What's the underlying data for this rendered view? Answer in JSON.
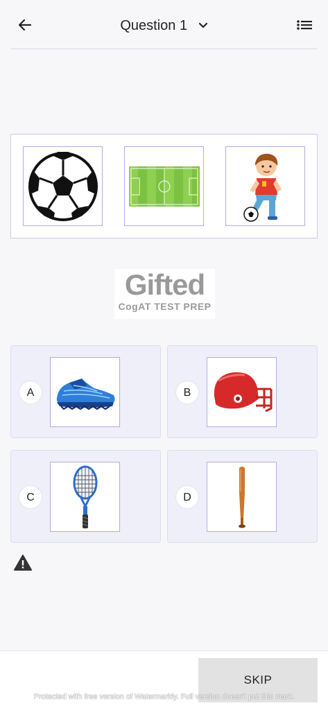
{
  "header": {
    "back_icon": "arrow-left-icon",
    "title": "Question 1",
    "dropdown_icon": "chevron-down-icon",
    "menu_icon": "list-icon"
  },
  "question": {
    "images": [
      "soccer-ball",
      "soccer-field",
      "boy-with-soccer-ball"
    ]
  },
  "logo": {
    "word": "Gifted",
    "subtitle": "CogAT TEST PREP"
  },
  "options": [
    {
      "letter": "A",
      "image": "running-shoe"
    },
    {
      "letter": "B",
      "image": "football-helmet"
    },
    {
      "letter": "C",
      "image": "tennis-racket"
    },
    {
      "letter": "D",
      "image": "baseball-bat"
    }
  ],
  "report_icon": "warning-icon",
  "footer": {
    "skip_label": "SKIP",
    "watermark": "Protected with free version of Watermarkly. Full version doesn't put this mark."
  },
  "colors": {
    "option_bg": "#eeeff9",
    "frame_border": "#b8a9e3",
    "skip_bg": "#e2e2e2"
  }
}
